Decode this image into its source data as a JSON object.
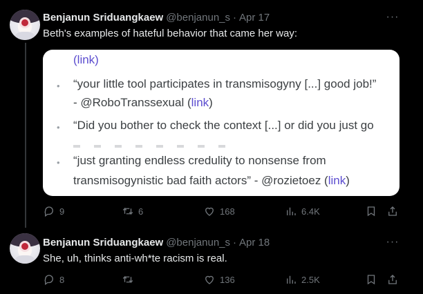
{
  "tweets": [
    {
      "author": "Benjanun Sriduangkaew",
      "handle": "@benjanun_s",
      "separator": "·",
      "date": "Apr 17",
      "more": "···",
      "text": "Beth's examples of hateful behavior that came her way:",
      "quote": {
        "top_link": "(link)",
        "items": [
          {
            "line1": "“your little tool participates in transmisogyny [...] good job!”",
            "line2_pre": "- @RoboTranssexual (",
            "link": "link",
            "line2_post": ")"
          },
          {
            "line1": "“Did you bother to check the context [...] or did you just go"
          },
          {
            "line1": "“just granting endless credulity to nonsense from",
            "line2_pre": "transmisogynistic bad faith actors” - @rozietoez (",
            "link": "link",
            "line2_post": ")"
          }
        ],
        "bullet": "•"
      },
      "stats": {
        "replies": "9",
        "reposts": "6",
        "likes": "168",
        "views": "6.4K"
      }
    },
    {
      "author": "Benjanun Sriduangkaew",
      "handle": "@benjanun_s",
      "separator": "·",
      "date": "Apr 18",
      "more": "···",
      "text": "She, uh, thinks anti-wh*te racism is real.",
      "stats": {
        "replies": "8",
        "reposts": "",
        "likes": "136",
        "views": "2.5K"
      }
    }
  ],
  "icons": [
    "reply-icon",
    "repost-icon",
    "like-icon",
    "views-icon",
    "bookmark-icon",
    "share-icon",
    "more-icon"
  ],
  "colors": {
    "background": "#000000",
    "text": "#e7e9ea",
    "muted": "#71767b",
    "link": "#5b4ccf"
  }
}
